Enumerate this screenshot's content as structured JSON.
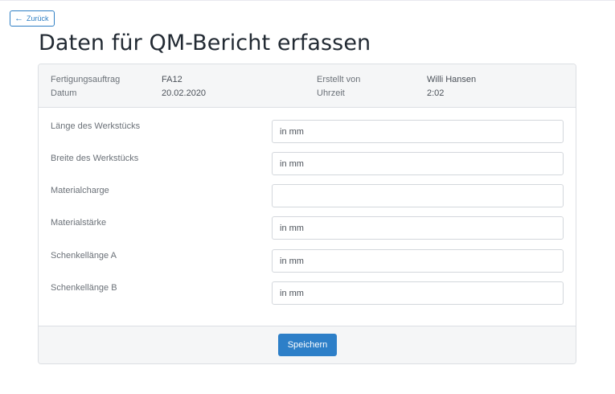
{
  "nav": {
    "back_label": "Zurück",
    "back_icon": "arrow-left-icon"
  },
  "page": {
    "title": "Daten für QM-Bericht erfassen"
  },
  "header": {
    "order_label": "Fertigungsauftrag",
    "order_value": "FA12",
    "date_label": "Datum",
    "date_value": "20.02.2020",
    "created_by_label": "Erstellt von",
    "created_by_value": "Willi Hansen",
    "time_label": "Uhrzeit",
    "time_value": "2:02"
  },
  "form": {
    "fields": [
      {
        "label": "Länge des Werkstücks",
        "placeholder": "in mm",
        "value": ""
      },
      {
        "label": "Breite des Werkstücks",
        "placeholder": "in mm",
        "value": ""
      },
      {
        "label": "Materialcharge",
        "placeholder": "",
        "value": ""
      },
      {
        "label": "Materialstärke",
        "placeholder": "in mm",
        "value": ""
      },
      {
        "label": "Schenkellänge A",
        "placeholder": "in mm",
        "value": ""
      },
      {
        "label": "Schenkellänge B",
        "placeholder": "in mm",
        "value": ""
      }
    ]
  },
  "footer": {
    "save_label": "Speichern"
  },
  "colors": {
    "accent": "#2d7fc8",
    "header_bg": "#f5f6f7",
    "border": "#dcdfe3"
  }
}
